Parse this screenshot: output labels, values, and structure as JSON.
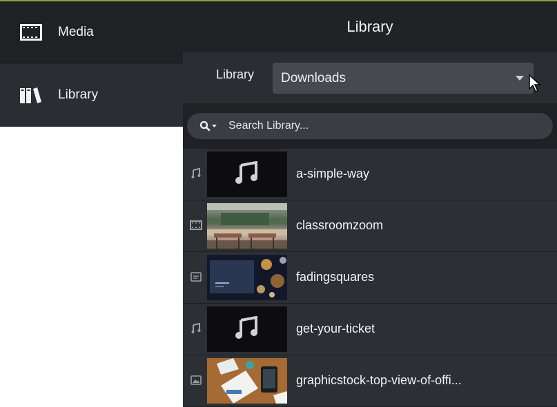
{
  "colors": {
    "accent_line": "#8aa14a",
    "sidebar_bg": "#2a2d31",
    "panel_bg": "#2c2f33",
    "header_bg": "#202225",
    "select_bg": "#464a50"
  },
  "sidebar": {
    "items": [
      {
        "label": "Media",
        "icon": "film-strip-icon",
        "selected": false
      },
      {
        "label": "Library",
        "icon": "books-icon",
        "selected": true
      }
    ]
  },
  "panel": {
    "title": "Library",
    "library_label": "Library",
    "library_selected": "Downloads"
  },
  "search": {
    "placeholder": "Search Library..."
  },
  "items": [
    {
      "name": "a-simple-way",
      "type": "audio",
      "type_icon": "music-note-icon"
    },
    {
      "name": "classroomzoom",
      "type": "video",
      "type_icon": "film-strip-icon"
    },
    {
      "name": "fadingsquares",
      "type": "template",
      "type_icon": "caption-icon"
    },
    {
      "name": "get-your-ticket",
      "type": "audio",
      "type_icon": "music-note-icon"
    },
    {
      "name": "graphicstock-top-view-of-offi...",
      "type": "image",
      "type_icon": "image-icon"
    }
  ]
}
